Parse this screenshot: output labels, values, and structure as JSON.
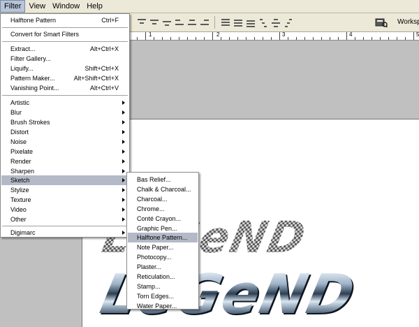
{
  "menubar": {
    "items": [
      "Filter",
      "View",
      "Window",
      "Help"
    ]
  },
  "options_bar": {
    "workspace_label": "Worksp"
  },
  "ruler": {
    "labels": [
      "1",
      "2",
      "3",
      "4",
      "5"
    ]
  },
  "canvas": {
    "logo_top_text": "LeGeND",
    "logo_bottom_text": "LeGeND"
  },
  "filter_menu": {
    "last_filter": "Halftone Pattern",
    "last_filter_shortcut": "Ctrl+F",
    "convert": "Convert for Smart Filters",
    "extract": "Extract...",
    "extract_shortcut": "Alt+Ctrl+X",
    "filter_gallery": "Filter Gallery...",
    "liquify": "Liquify...",
    "liquify_shortcut": "Shift+Ctrl+X",
    "pattern_maker": "Pattern Maker...",
    "pattern_maker_shortcut": "Alt+Shift+Ctrl+X",
    "vanishing_point": "Vanishing Point...",
    "vanishing_point_shortcut": "Alt+Ctrl+V",
    "artistic": "Artistic",
    "blur": "Blur",
    "brush_strokes": "Brush Strokes",
    "distort": "Distort",
    "noise": "Noise",
    "pixelate": "Pixelate",
    "render": "Render",
    "sharpen": "Sharpen",
    "sketch": "Sketch",
    "stylize": "Stylize",
    "texture": "Texture",
    "video": "Video",
    "other": "Other",
    "digimarc": "Digimarc"
  },
  "sketch_menu": {
    "items": [
      "Bas Relief...",
      "Chalk & Charcoal...",
      "Charcoal...",
      "Chrome...",
      "Conté Crayon...",
      "Graphic Pen...",
      "Halftone Pattern...",
      "Note Paper...",
      "Photocopy...",
      "Plaster...",
      "Reticulation...",
      "Stamp...",
      "Torn Edges...",
      "Water Paper..."
    ]
  }
}
